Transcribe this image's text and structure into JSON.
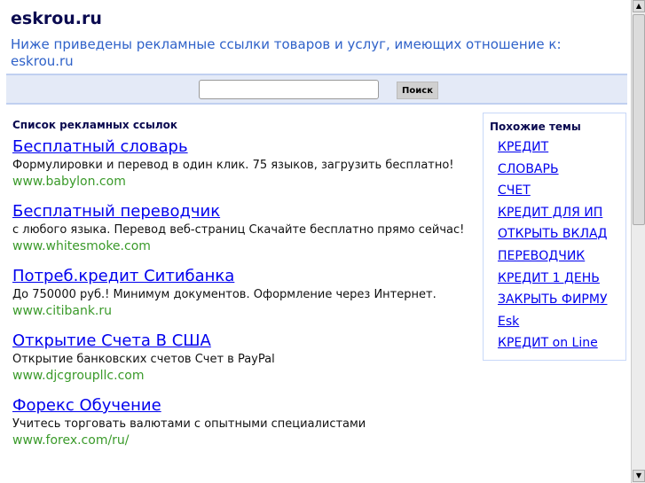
{
  "header": {
    "title": "eskrou.ru",
    "subtitle": "Ниже приведены рекламные ссылки товаров и услуг, имеющих отношение к: eskrou.ru"
  },
  "search": {
    "value": "",
    "button": "Поиск"
  },
  "ads": {
    "heading": "Список рекламных ссылок",
    "items": [
      {
        "title": "Бесплатный словарь",
        "desc": "Формулировки и перевод в один клик. 75 языков, загрузить бесплатно!",
        "url": "www.babylon.com"
      },
      {
        "title": "Бесплатный переводчик",
        "desc": "с любого языка. Перевод веб-страниц Скачайте бесплатно прямо сейчас!",
        "url": "www.whitesmoke.com"
      },
      {
        "title": "Потреб.кредит Ситибанка",
        "desc": "До 750000 руб.! Минимум документов. Оформление через Интернет.",
        "url": "www.citibank.ru"
      },
      {
        "title": "Открытие Счета В США",
        "desc": "Открытие банковских счетов Счет в PayPal",
        "url": "www.djcgroupllc.com"
      },
      {
        "title": "Форекс Обучение",
        "desc": "Учитесь торговать валютами с опытными специалистами",
        "url": "www.forex.com/ru/"
      }
    ]
  },
  "related": {
    "heading": "Похожие темы",
    "items": [
      "КРЕДИТ",
      "СЛОВАРЬ",
      "СЧЕТ",
      "КРЕДИТ ДЛЯ ИП",
      "ОТКРЫТЬ ВКЛАД",
      "ПЕРЕВОДЧИК",
      "КРЕДИТ 1 ДЕНЬ",
      "ЗАКРЫТЬ ФИРМУ",
      "Esk",
      "КРЕДИТ on Line"
    ]
  }
}
